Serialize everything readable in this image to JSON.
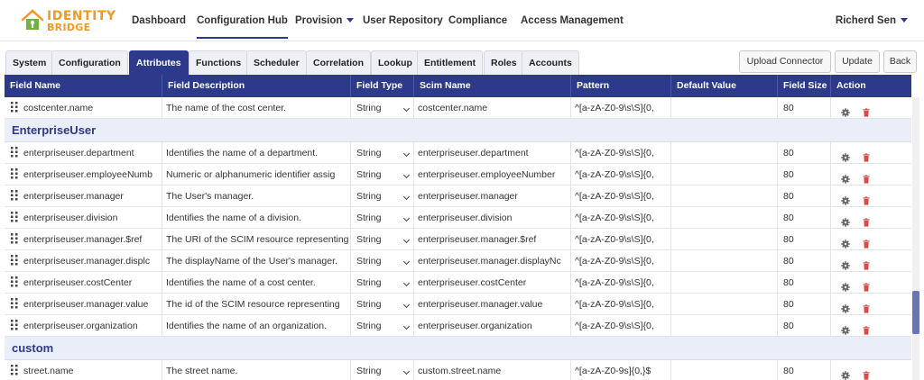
{
  "brand": {
    "line1": "IDENTITY",
    "line2": "BRIDGE"
  },
  "nav": {
    "items": [
      {
        "label": "Dashboard"
      },
      {
        "label": "Configuration Hub"
      },
      {
        "label": "Provision"
      },
      {
        "label": "User Repository"
      },
      {
        "label": "Compliance"
      },
      {
        "label": "Access Management"
      }
    ],
    "active": "Configuration Hub",
    "user": "Richerd Sen"
  },
  "tabs": [
    "System",
    "Configuration",
    "Attributes",
    "Functions",
    "Scheduler",
    "Correlation",
    "Lookup",
    "Entitlement",
    "Roles",
    "Accounts"
  ],
  "active_tab": "Attributes",
  "buttons": {
    "upload": "Upload Connector",
    "update": "Update",
    "back": "Back"
  },
  "table": {
    "headers": [
      "Field Name",
      "Field Description",
      "Field Type",
      "Scim Name",
      "Pattern",
      "Default Value",
      "Field Size",
      "Action"
    ],
    "rows": [
      {
        "name": "costcenter.name",
        "desc": "The name of the cost center.",
        "type": "String",
        "scim": "costcenter.name",
        "pattern": "^[a-zA-Z0-9\\s\\S]{0,",
        "default": "",
        "size": "80"
      }
    ],
    "groups": [
      {
        "title": "EnterpriseUser",
        "rows": [
          {
            "name": "enterpriseuser.department",
            "desc": "Identifies the name of a department.",
            "type": "String",
            "scim": "enterpriseuser.department",
            "pattern": "^[a-zA-Z0-9\\s\\S]{0,",
            "default": "",
            "size": "80"
          },
          {
            "name": "enterpriseuser.employeeNumb",
            "desc": "Numeric or alphanumeric identifier assig",
            "type": "String",
            "scim": "enterpriseuser.employeeNumber",
            "pattern": "^[a-zA-Z0-9\\s\\S]{0,",
            "default": "",
            "size": "80"
          },
          {
            "name": "enterpriseuser.manager",
            "desc": "The User's manager.",
            "type": "String",
            "scim": "enterpriseuser.manager",
            "pattern": "^[a-zA-Z0-9\\s\\S]{0,",
            "default": "",
            "size": "80"
          },
          {
            "name": "enterpriseuser.division",
            "desc": "Identifies the name of a division.",
            "type": "String",
            "scim": "enterpriseuser.division",
            "pattern": "^[a-zA-Z0-9\\s\\S]{0,",
            "default": "",
            "size": "80"
          },
          {
            "name": "enterpriseuser.manager.$ref",
            "desc": "The URI of the SCIM resource representing",
            "type": "String",
            "scim": "enterpriseuser.manager.$ref",
            "pattern": "^[a-zA-Z0-9\\s\\S]{0,",
            "default": "",
            "size": "80"
          },
          {
            "name": "enterpriseuser.manager.displc",
            "desc": "The displayName of the User's manager.",
            "type": "String",
            "scim": "enterpriseuser.manager.displayNc",
            "pattern": "^[a-zA-Z0-9\\s\\S]{0,",
            "default": "",
            "size": "80"
          },
          {
            "name": "enterpriseuser.costCenter",
            "desc": "Identifies the name of a cost center.",
            "type": "String",
            "scim": "enterpriseuser.costCenter",
            "pattern": "^[a-zA-Z0-9\\s\\S]{0,",
            "default": "",
            "size": "80"
          },
          {
            "name": "enterpriseuser.manager.value",
            "desc": "The id of the SCIM resource representing",
            "type": "String",
            "scim": "enterpriseuser.manager.value",
            "pattern": "^[a-zA-Z0-9\\s\\S]{0,",
            "default": "",
            "size": "80"
          },
          {
            "name": "enterpriseuser.organization",
            "desc": "Identifies the name of an organization.",
            "type": "String",
            "scim": "enterpriseuser.organization",
            "pattern": "^[a-zA-Z0-9\\s\\S]{0,",
            "default": "",
            "size": "80"
          }
        ]
      },
      {
        "title": "custom",
        "rows": [
          {
            "name": "street.name",
            "desc": "The street name.",
            "type": "String",
            "scim": "custom.street.name",
            "pattern": "^[a-zA-Z0-9s]{0,}$",
            "default": "",
            "size": "80"
          }
        ]
      }
    ]
  },
  "icons": {
    "drag": "drag-handle-icon",
    "settings": "gear-icon",
    "delete": "trash-icon"
  },
  "colors": {
    "primary": "#2d3a8c",
    "accent": "#f39a1e",
    "group_bg": "#eaeef8",
    "delete": "#e04848"
  }
}
